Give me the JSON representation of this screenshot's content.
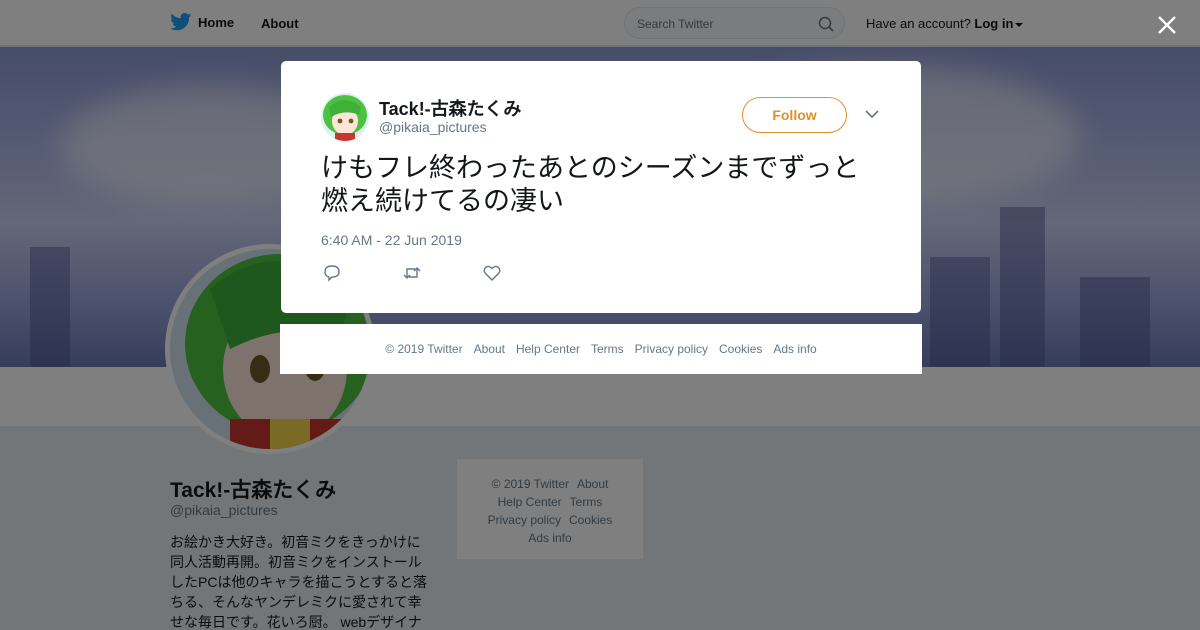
{
  "topbar": {
    "home_label": "Home",
    "about_label": "About",
    "search_placeholder": "Search Twitter",
    "have_account": "Have an account?",
    "login_label": "Log in"
  },
  "profile": {
    "name": "Tack!-古森たくみ",
    "handle": "@pikaia_pictures",
    "bio_lines": [
      "お絵かき大好き。初音ミクをきっかけに",
      "同人活動再開。初音ミクをインストール",
      "したPCは他のキャラを描こうとすると落",
      "ちる、そんなヤンデレミクに愛されて幸",
      "せな毎日です。花いろ厨。 webデザイナ"
    ]
  },
  "side_footer": {
    "copyright": "© 2019 Twitter",
    "about": "About",
    "help": "Help Center",
    "terms": "Terms",
    "privacy": "Privacy policy",
    "cookies": "Cookies",
    "ads": "Ads info"
  },
  "tweet": {
    "name": "Tack!-古森たくみ",
    "handle": "@pikaia_pictures",
    "follow_label": "Follow",
    "text": "けもフレ終わったあとのシーズンまでずっと燃え続けてるの凄い",
    "timestamp": "6:40 AM - 22 Jun 2019"
  },
  "modal_footer": {
    "copyright": "© 2019 Twitter",
    "about": "About",
    "help": "Help Center",
    "terms": "Terms",
    "privacy": "Privacy policy",
    "cookies": "Cookies",
    "ads": "Ads info"
  },
  "colors": {
    "accent": "#e0902a",
    "twitter_blue": "#1da1f2",
    "overlay": "rgba(0,0,0,0.5)"
  },
  "icons": [
    "twitter-bird-icon",
    "search-icon",
    "caret-down-icon",
    "close-icon",
    "chevron-down-icon",
    "reply-icon",
    "retweet-icon",
    "like-icon"
  ]
}
